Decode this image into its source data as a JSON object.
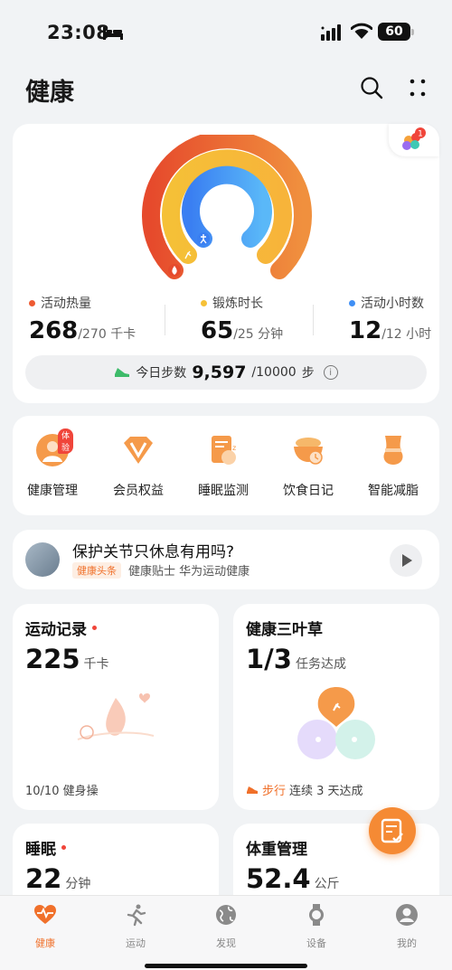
{
  "status_bar": {
    "time": "23:08",
    "battery": "60"
  },
  "header": {
    "title": "健康"
  },
  "rings": {
    "metrics": [
      {
        "label": "活动热量",
        "value": "268",
        "goal": "/270",
        "unit": "千卡",
        "color": "#ee5a32"
      },
      {
        "label": "锻炼时长",
        "value": "65",
        "goal": "/25",
        "unit": "分钟",
        "color": "#f6c137"
      },
      {
        "label": "活动小时数",
        "value": "12",
        "goal": "/12",
        "unit": "小时",
        "color": "#3f8ff5"
      }
    ],
    "steps": {
      "label": "今日步数",
      "value": "9,597",
      "goal": "/10000",
      "unit": "步"
    }
  },
  "shortcuts": [
    {
      "label": "健康管理",
      "badge": "体验"
    },
    {
      "label": "会员权益"
    },
    {
      "label": "睡眠监测"
    },
    {
      "label": "饮食日记"
    },
    {
      "label": "智能减脂"
    }
  ],
  "article": {
    "title": "保护关节只休息有用吗?",
    "tag": "健康头条",
    "meta": "健康贴士 华为运动健康"
  },
  "exercise": {
    "title": "运动记录",
    "value": "225",
    "unit": "千卡",
    "footer": "10/10 健身操"
  },
  "clover": {
    "title": "健康三叶草",
    "value": "1/3",
    "unit": "任务达成",
    "footer_highlight": "步行",
    "footer": "连续 3 天达成"
  },
  "sleep": {
    "title": "睡眠",
    "value": "22",
    "unit": "分钟"
  },
  "weight": {
    "title": "体重管理",
    "value": "52.4",
    "unit": "公斤"
  },
  "nav": [
    {
      "label": "健康",
      "active": true
    },
    {
      "label": "运动"
    },
    {
      "label": "发现"
    },
    {
      "label": "设备"
    },
    {
      "label": "我的"
    }
  ],
  "colors": {
    "accent": "#f0702a",
    "ring_outer": "#ee5a32",
    "ring_middle": "#f6c137",
    "ring_inner": "#3f8ff5"
  }
}
